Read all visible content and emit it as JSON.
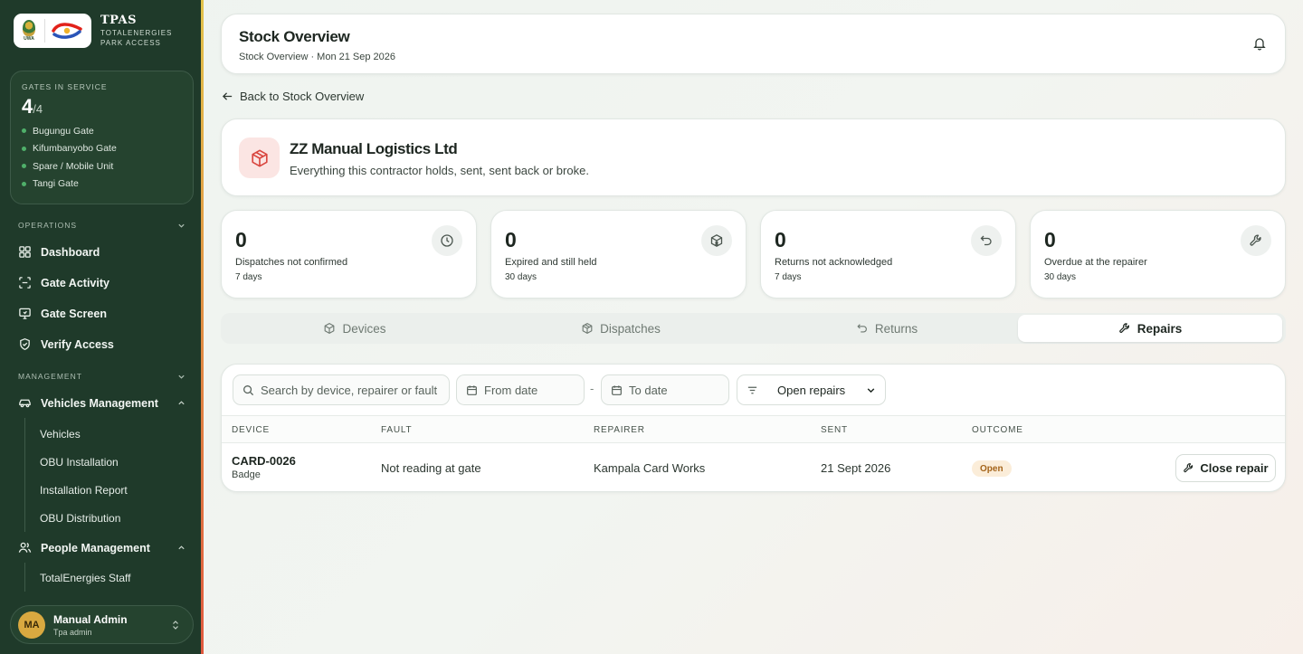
{
  "brand": {
    "short": "TPAS",
    "line1": "TOTALENERGIES",
    "line2": "PARK ACCESS",
    "logo_left_text": "UWA"
  },
  "gates": {
    "label": "GATES IN SERVICE",
    "in_service": "4",
    "total": "/4",
    "items": [
      "Bugungu Gate",
      "Kifumbanyobo Gate",
      "Spare / Mobile Unit",
      "Tangi Gate"
    ]
  },
  "sidebar": {
    "operations_label": "OPERATIONS",
    "operations": [
      {
        "label": "Dashboard",
        "icon": "grid-icon"
      },
      {
        "label": "Gate Activity",
        "icon": "scan-icon"
      },
      {
        "label": "Gate Screen",
        "icon": "monitor-icon"
      },
      {
        "label": "Verify Access",
        "icon": "shield-check-icon"
      }
    ],
    "management_label": "MANAGEMENT",
    "vehicles_label": "Vehicles Management",
    "vehicles_items": [
      "Vehicles",
      "OBU Installation",
      "Installation Report",
      "OBU Distribution"
    ],
    "people_label": "People Management",
    "people_items": [
      "TotalEnergies Staff"
    ]
  },
  "user": {
    "initials": "MA",
    "name": "Manual Admin",
    "role": "Tpa admin"
  },
  "header": {
    "title": "Stock Overview",
    "crumb": "Stock Overview · Mon 21 Sep 2026"
  },
  "back_label": "Back to Stock Overview",
  "contractor": {
    "name": "ZZ Manual Logistics Ltd",
    "description": "Everything this contractor holds, sent, sent back or broke."
  },
  "stats": [
    {
      "value": "0",
      "label": "Dispatches not confirmed",
      "period": "7 days",
      "icon": "clock-icon"
    },
    {
      "value": "0",
      "label": "Expired and still held",
      "period": "30 days",
      "icon": "package-x-icon"
    },
    {
      "value": "0",
      "label": "Returns not acknowledged",
      "period": "7 days",
      "icon": "undo-icon"
    },
    {
      "value": "0",
      "label": "Overdue at the repairer",
      "period": "30 days",
      "icon": "wrench-icon"
    }
  ],
  "tabs": [
    {
      "label": "Devices",
      "icon": "box-icon"
    },
    {
      "label": "Dispatches",
      "icon": "package-icon"
    },
    {
      "label": "Returns",
      "icon": "undo-icon"
    },
    {
      "label": "Repairs",
      "icon": "wrench-icon",
      "active": true
    }
  ],
  "filters": {
    "search_placeholder": "Search by device, repairer or fault",
    "from_placeholder": "From date",
    "separator": "-",
    "to_placeholder": "To date",
    "status": "Open repairs"
  },
  "table": {
    "columns": [
      "DEVICE",
      "FAULT",
      "REPAIRER",
      "SENT",
      "OUTCOME"
    ],
    "rows": [
      {
        "device": "CARD-0026",
        "device_type": "Badge",
        "fault": "Not reading at gate",
        "repairer": "Kampala Card Works",
        "sent": "21 Sept 2026",
        "outcome": "Open",
        "action": "Close repair"
      }
    ]
  },
  "colors": {
    "sidebar": "#1f3a2a",
    "accent_badge": "#fbedd9",
    "avatar": "#d9a940"
  }
}
